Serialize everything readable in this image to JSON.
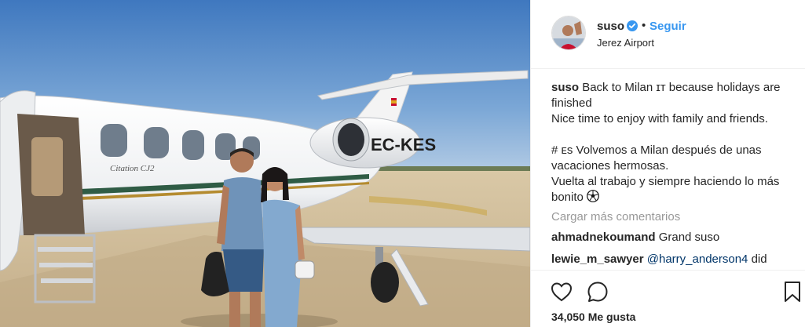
{
  "post": {
    "username": "suso",
    "separator": "•",
    "follow_label": "Seguir",
    "location": "Jerez Airport",
    "caption": {
      "username": "suso",
      "line1": "Back to Milan ɪᴛ because holidays are finished",
      "line2": "Nice time to enjoy with family and friends.",
      "line3": "# ᴇs Volvemos a Milan después de unas vacaciones hermosas.",
      "line4": "Vuelta al trabajo y siempre haciendo lo más bonito"
    },
    "load_more": "Cargar más comentarios",
    "comments": [
      {
        "user": "ahmadnekoumand",
        "text": "Grand suso"
      },
      {
        "user": "lewie_m_sawyer",
        "mention": "@harry_anderson4",
        "text": "did"
      }
    ],
    "likes": "34,050 Me gusta",
    "plane_registration": "EC-KES",
    "plane_brand": "Citation CJ2"
  },
  "colors": {
    "link": "#3897f0",
    "verified": "#3897f0",
    "sky": "#4f86c6",
    "tarmac": "#cdbb9c"
  },
  "icons": [
    "verified-badge-icon",
    "heart-icon",
    "comment-bubble-icon",
    "bookmark-icon",
    "soccer-ball-icon"
  ]
}
